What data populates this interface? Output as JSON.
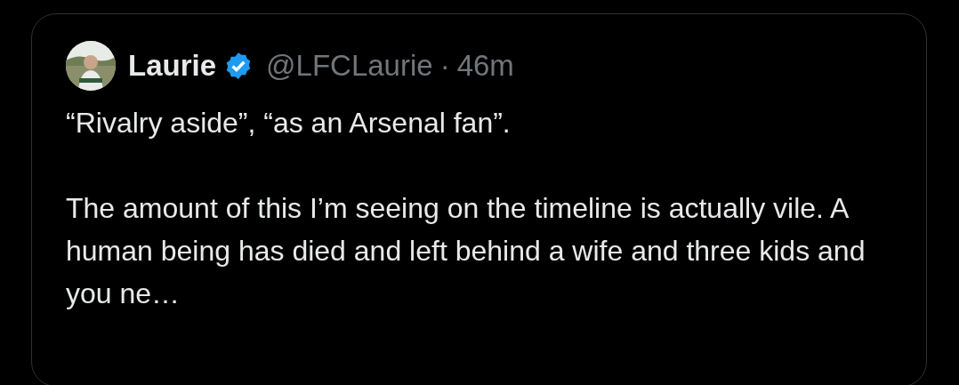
{
  "quoted_post": {
    "author": {
      "name": "Laurie",
      "verified": true,
      "handle": "@LFCLaurie",
      "separator": "·",
      "time": "46m"
    },
    "paragraphs": [
      "“Rivalry aside”, “as an Arsenal fan”.",
      "The amount of this I’m seeing on the timeline is actually vile. A human being has died and left behind a wife and three kids and you ne…"
    ]
  }
}
